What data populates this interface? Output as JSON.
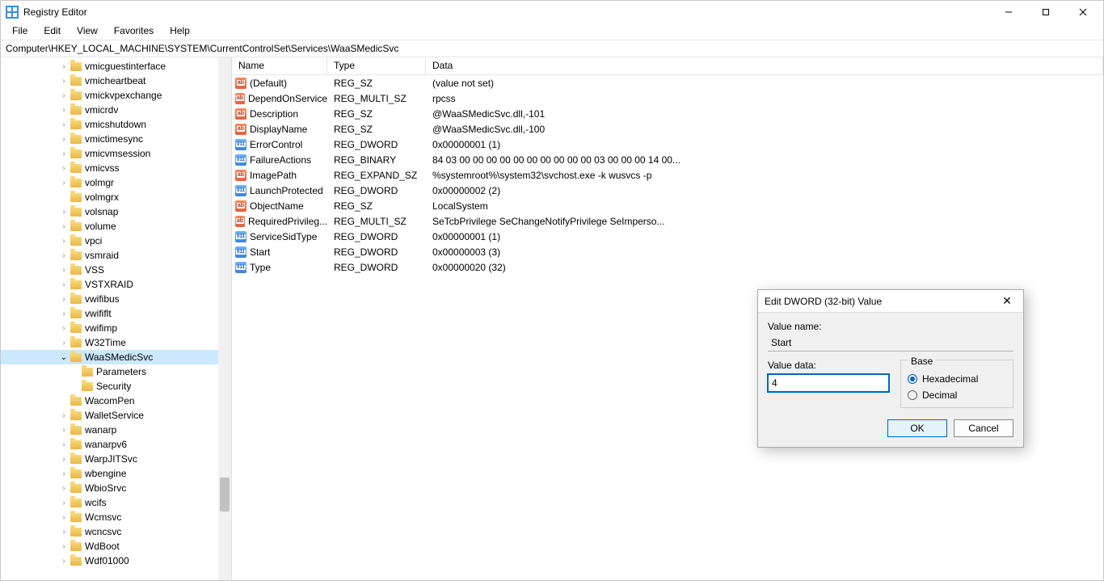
{
  "titlebar": {
    "title": "Registry Editor"
  },
  "menu": [
    "File",
    "Edit",
    "View",
    "Favorites",
    "Help"
  ],
  "address": "Computer\\HKEY_LOCAL_MACHINE\\SYSTEM\\CurrentControlSet\\Services\\WaaSMedicSvc",
  "tree": [
    {
      "label": "vmicguestinterface",
      "depth": 3,
      "caret": true
    },
    {
      "label": "vmicheartbeat",
      "depth": 3,
      "caret": true
    },
    {
      "label": "vmickvpexchange",
      "depth": 3,
      "caret": true
    },
    {
      "label": "vmicrdv",
      "depth": 3,
      "caret": true
    },
    {
      "label": "vmicshutdown",
      "depth": 3,
      "caret": true
    },
    {
      "label": "vmictimesync",
      "depth": 3,
      "caret": true
    },
    {
      "label": "vmicvmsession",
      "depth": 3,
      "caret": true
    },
    {
      "label": "vmicvss",
      "depth": 3,
      "caret": true
    },
    {
      "label": "volmgr",
      "depth": 3,
      "caret": true
    },
    {
      "label": "volmgrx",
      "depth": 3,
      "caret": false
    },
    {
      "label": "volsnap",
      "depth": 3,
      "caret": true
    },
    {
      "label": "volume",
      "depth": 3,
      "caret": true
    },
    {
      "label": "vpci",
      "depth": 3,
      "caret": true
    },
    {
      "label": "vsmraid",
      "depth": 3,
      "caret": true
    },
    {
      "label": "VSS",
      "depth": 3,
      "caret": true
    },
    {
      "label": "VSTXRAID",
      "depth": 3,
      "caret": true
    },
    {
      "label": "vwifibus",
      "depth": 3,
      "caret": true
    },
    {
      "label": "vwififlt",
      "depth": 3,
      "caret": true
    },
    {
      "label": "vwifimp",
      "depth": 3,
      "caret": true
    },
    {
      "label": "W32Time",
      "depth": 3,
      "caret": true
    },
    {
      "label": "WaaSMedicSvc",
      "depth": 3,
      "caret": true,
      "open": true,
      "selected": true
    },
    {
      "label": "Parameters",
      "depth": 4,
      "caret": false
    },
    {
      "label": "Security",
      "depth": 4,
      "caret": false
    },
    {
      "label": "WacomPen",
      "depth": 3,
      "caret": false
    },
    {
      "label": "WalletService",
      "depth": 3,
      "caret": true
    },
    {
      "label": "wanarp",
      "depth": 3,
      "caret": true
    },
    {
      "label": "wanarpv6",
      "depth": 3,
      "caret": true
    },
    {
      "label": "WarpJITSvc",
      "depth": 3,
      "caret": true
    },
    {
      "label": "wbengine",
      "depth": 3,
      "caret": true
    },
    {
      "label": "WbioSrvc",
      "depth": 3,
      "caret": true
    },
    {
      "label": "wcifs",
      "depth": 3,
      "caret": true
    },
    {
      "label": "Wcmsvc",
      "depth": 3,
      "caret": true
    },
    {
      "label": "wcncsvc",
      "depth": 3,
      "caret": true
    },
    {
      "label": "WdBoot",
      "depth": 3,
      "caret": true
    },
    {
      "label": "Wdf01000",
      "depth": 3,
      "caret": true
    }
  ],
  "columns": {
    "name": "Name",
    "type": "Type",
    "data": "Data"
  },
  "values": [
    {
      "icon": "str",
      "name": "(Default)",
      "type": "REG_SZ",
      "data": "(value not set)"
    },
    {
      "icon": "str",
      "name": "DependOnService",
      "type": "REG_MULTI_SZ",
      "data": "rpcss"
    },
    {
      "icon": "str",
      "name": "Description",
      "type": "REG_SZ",
      "data": "@WaaSMedicSvc.dll,-101"
    },
    {
      "icon": "str",
      "name": "DisplayName",
      "type": "REG_SZ",
      "data": "@WaaSMedicSvc.dll,-100"
    },
    {
      "icon": "bin",
      "name": "ErrorControl",
      "type": "REG_DWORD",
      "data": "0x00000001 (1)"
    },
    {
      "icon": "bin",
      "name": "FailureActions",
      "type": "REG_BINARY",
      "data": "84 03 00 00 00 00 00 00 00 00 00 00 03 00 00 00 14 00..."
    },
    {
      "icon": "str",
      "name": "ImagePath",
      "type": "REG_EXPAND_SZ",
      "data": "%systemroot%\\system32\\svchost.exe -k wusvcs -p"
    },
    {
      "icon": "bin",
      "name": "LaunchProtected",
      "type": "REG_DWORD",
      "data": "0x00000002 (2)"
    },
    {
      "icon": "str",
      "name": "ObjectName",
      "type": "REG_SZ",
      "data": "LocalSystem"
    },
    {
      "icon": "str",
      "name": "RequiredPrivileg...",
      "type": "REG_MULTI_SZ",
      "data": "SeTcbPrivilege SeChangeNotifyPrivilege SeImperso..."
    },
    {
      "icon": "bin",
      "name": "ServiceSidType",
      "type": "REG_DWORD",
      "data": "0x00000001 (1)"
    },
    {
      "icon": "bin",
      "name": "Start",
      "type": "REG_DWORD",
      "data": "0x00000003 (3)"
    },
    {
      "icon": "bin",
      "name": "Type",
      "type": "REG_DWORD",
      "data": "0x00000020 (32)"
    }
  ],
  "dialog": {
    "title": "Edit DWORD (32-bit) Value",
    "valueNameLabel": "Value name:",
    "valueName": "Start",
    "valueDataLabel": "Value data:",
    "valueData": "4",
    "baseLabel": "Base",
    "hex": "Hexadecimal",
    "dec": "Decimal",
    "ok": "OK",
    "cancel": "Cancel"
  }
}
